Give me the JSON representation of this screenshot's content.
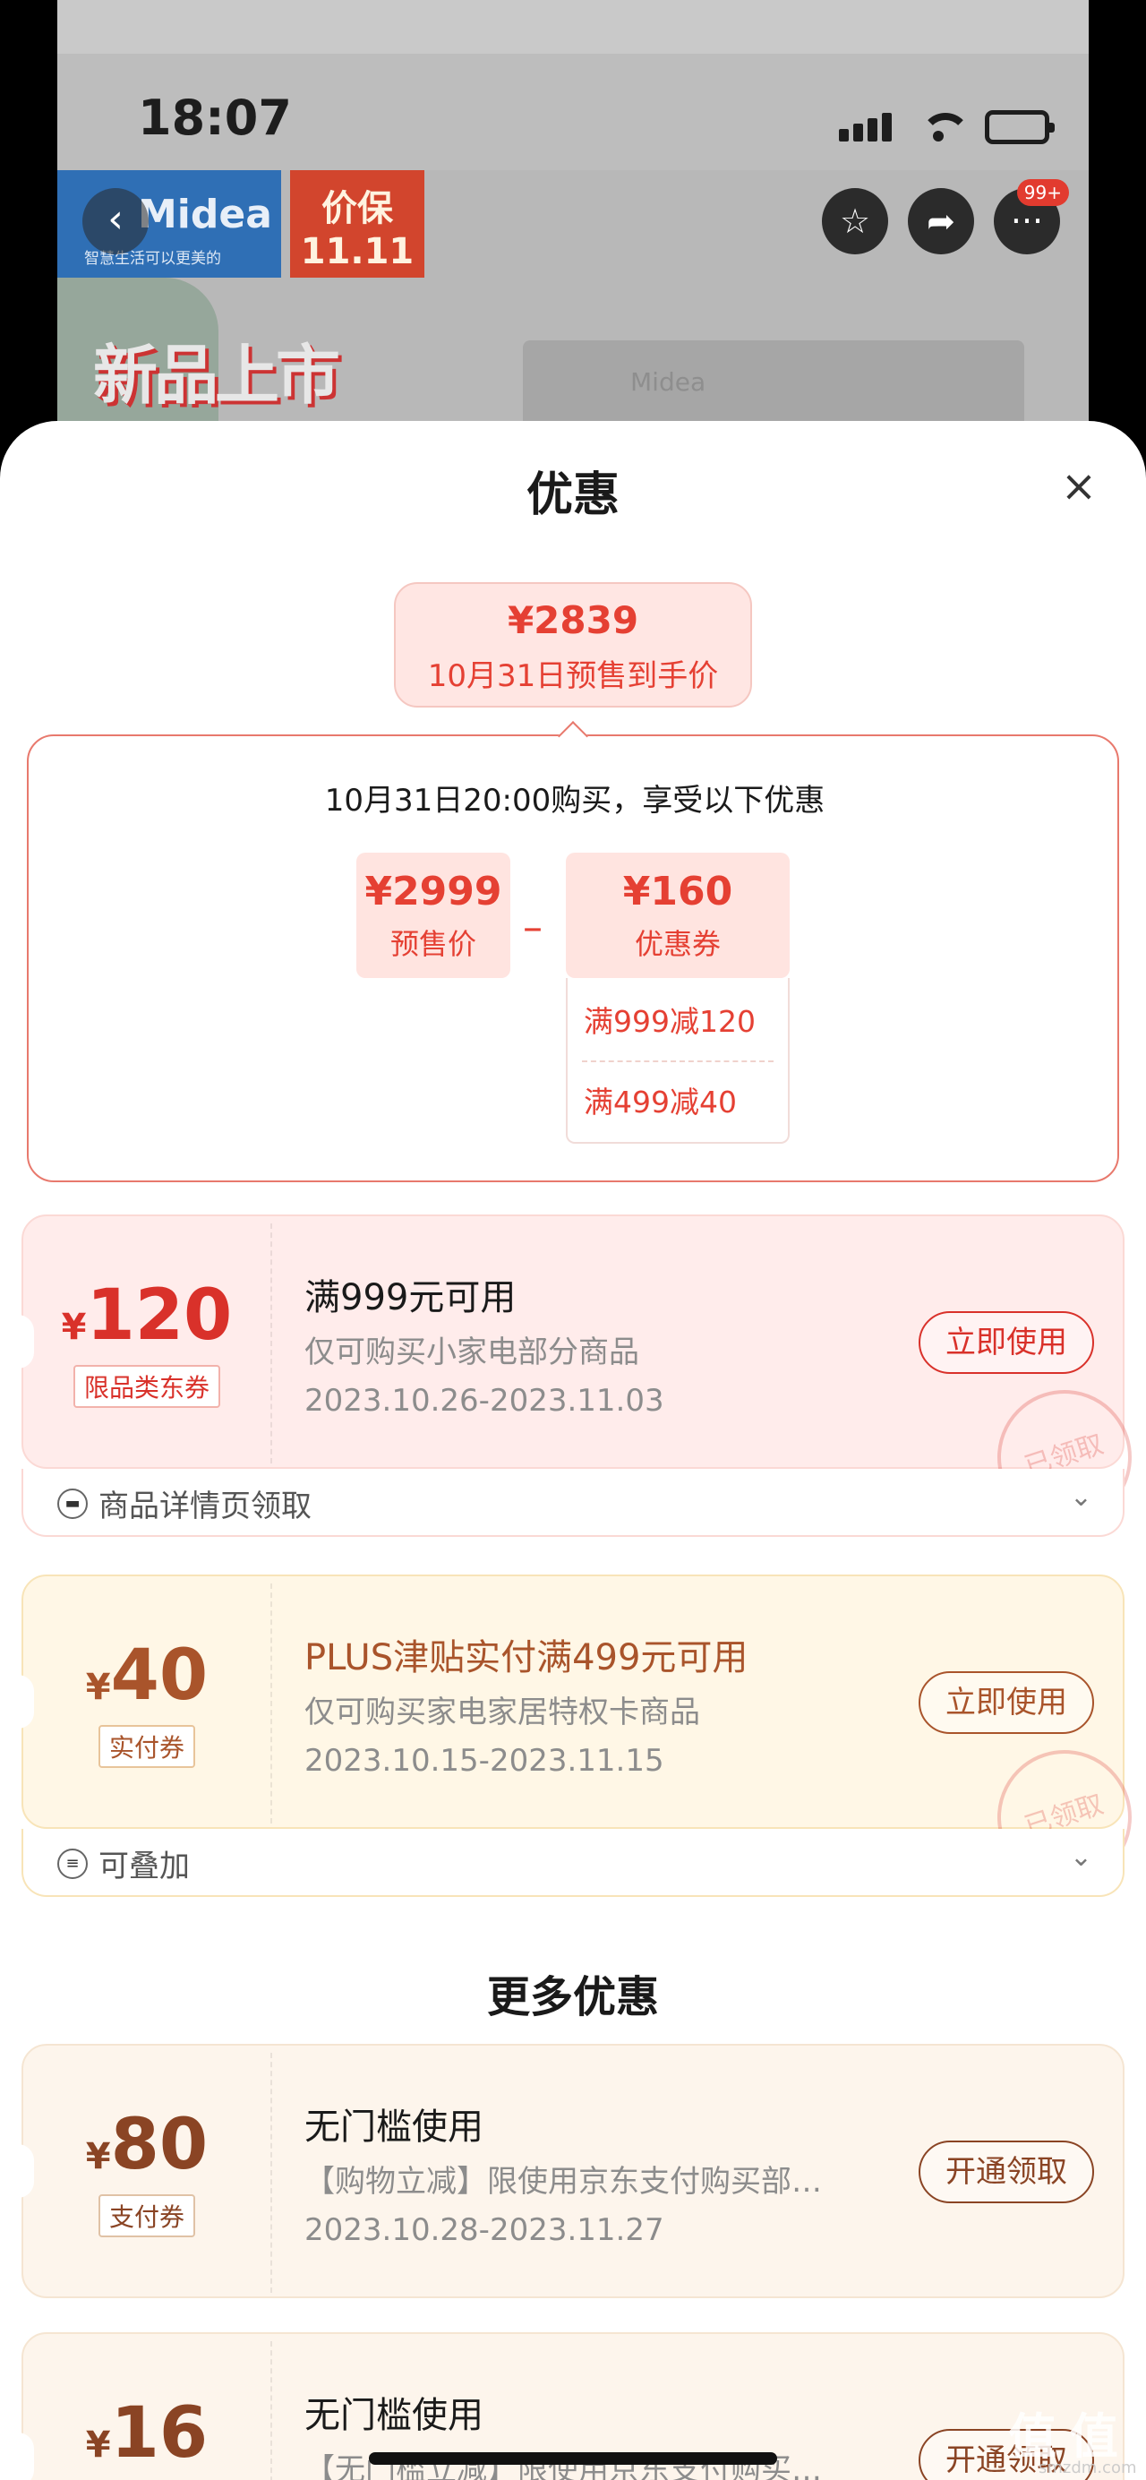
{
  "status_bar": {
    "time": "18:07"
  },
  "background_page": {
    "brand": "Midea",
    "brand_slogan": "智慧生活可以更美的",
    "badge_line1": "价保",
    "badge_line2": "11.11",
    "banner_text": "新品上市",
    "product_brand": "Midea",
    "notification_count": "99+"
  },
  "sheet": {
    "title": "优惠",
    "final_price": {
      "amount": "¥2839",
      "label": "10月31日预售到手价"
    },
    "calc": {
      "heading": "10月31日20:00购买，享受以下优惠",
      "presale": {
        "amount": "¥2999",
        "label": "预售价"
      },
      "operator": "–",
      "coupon": {
        "amount": "¥160",
        "label": "优惠券"
      },
      "coupon_rows": [
        "满999减120",
        "满499减40"
      ]
    },
    "coupons": [
      {
        "currency": "¥",
        "amount": "120",
        "type": "限品类东券",
        "condition": "满999元可用",
        "desc": "仅可购买小家电部分商品",
        "date": "2023.10.26-2023.11.03",
        "action": "立即使用",
        "stamp": "已领取",
        "footer": "商品详情页领取"
      },
      {
        "currency": "¥",
        "amount": "40",
        "type": "实付券",
        "condition": "PLUS津贴实付满499元可用",
        "desc": "仅可购买家电家居特权卡商品",
        "date": "2023.10.15-2023.11.15",
        "action": "立即使用",
        "stamp": "已领取",
        "footer": "可叠加"
      }
    ],
    "more_title": "更多优惠",
    "more_coupons": [
      {
        "currency": "¥",
        "amount": "80",
        "type": "支付券",
        "condition": "无门槛使用",
        "desc": "【购物立减】限使用京东支付购买部…",
        "date": "2023.10.28-2023.11.27",
        "action": "开通领取"
      },
      {
        "currency": "¥",
        "amount": "16",
        "condition": "无门槛使用",
        "desc": "【无门槛立减】限使用京东支付购买…",
        "action": "开通领取"
      }
    ]
  },
  "watermark": {
    "text": "值 值 值",
    "sub": "smzdm.com"
  },
  "colors": {
    "accent_red": "#e54033",
    "gold": "#a9542b",
    "brown": "#8a4424"
  }
}
